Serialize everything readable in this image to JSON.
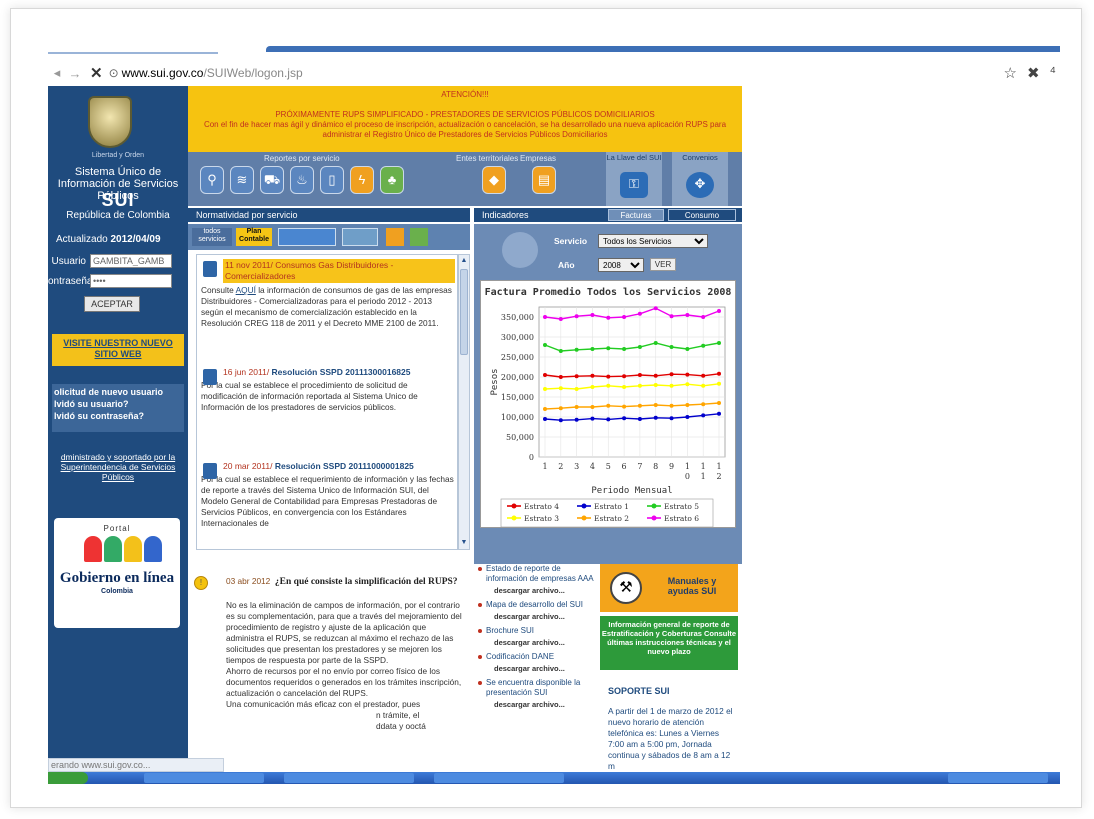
{
  "browser": {
    "url_domain": "www.sui.gov.co",
    "url_path": "/SUIWeb/logon.jsp",
    "status_text": "erando www.sui.gov.co..."
  },
  "left": {
    "motto": "Libertad y Orden",
    "system_name": "Sistema Único de Información de Servicios Públicos",
    "sui": "SUI",
    "republic": "República de Colombia",
    "updated_label": "Actualizado",
    "updated_value": "2012/04/09",
    "user_label": "Usuario",
    "user_value": "GAMBITA_GAMB",
    "password_label": "ontraseña",
    "password_value": "••••",
    "accept": "ACEPTAR",
    "visit": "VISITE NUESTRO NUEVO SITIO WEB",
    "help_1": "olicitud de nuevo usuario",
    "help_2": "lvidó su usuario?",
    "help_3": "lvidó su contraseña?",
    "admin": "dministrado y soportado por la Superintendencia de Servicios Públicos",
    "portal": "Portal",
    "gob": "Gobierno en línea",
    "colombia": "Colombia"
  },
  "notice": {
    "title": "ATENCIÓN!!!",
    "line1": "PRÓXIMAMENTE RUPS SIMPLIFICADO - PRESTADORES DE SERVICIOS PÚBLICOS DOMICILIARIOS",
    "line2": "Con el fin de hacer mas ágil y dinámico el proceso de inscripción, actualización o cancelación, se ha desarrollado una nueva aplicación RUPS para administrar el Registro Único de Prestadores de Servicios Públicos Domiciliarios"
  },
  "iconband": {
    "reportes": "Reportes por servicio",
    "entes": "Entes territoriales",
    "empresas": "Empresas",
    "llave": "La Llave del SUI",
    "convenios": "Convenios"
  },
  "sections": {
    "normatividad": "Normatividad por servicio",
    "indicadores": "Indicadores",
    "facturas": "Facturas",
    "consumo": "Consumo",
    "todos": "todos servicios",
    "plan": "Plan Contable"
  },
  "news": [
    {
      "date": "11 nov 2011",
      "title": "Consumos Gas Distribuidores - Comercializadores",
      "body_a": "Consulte ",
      "link": "AQUÍ",
      "body_b": " la información de consumos de gas de las empresas Distribuidores - Comercializadoras para el periodo 2012 - 2013 según el mecanismo de comercialización establecido en la Resolución CREG 118 de 2011 y el Decreto MME 2100 de 2011."
    },
    {
      "date": "16 jun 2011",
      "title": "Resolución SSPD 20111300016825",
      "body": "Por la cual se establece el procedimiento de solicitud de modificación de información reportada al Sistema Unico de Información de los prestadores de servicios públicos."
    },
    {
      "date": "20 mar 2011",
      "title": "Resolución SSPD 20111000001825",
      "body": "Por la cual se establece el requerimiento de información y las fechas de reporte a través del Sistema Unico de Información SUI, del Modelo General de Contabilidad para Empresas Prestadoras de Servicios Públicos, en convergencia con los Estándares Internacionales de"
    }
  ],
  "indicators": {
    "servicio_label": "Servicio",
    "servicio_value": "Todos los Servicios",
    "anio_label": "Año",
    "anio_value": "2008",
    "ver": "VER"
  },
  "chart_data": {
    "type": "line",
    "title": "Factura Promedio Todos los Servicios 2008",
    "xlabel": "Periodo Mensual",
    "ylabel": "Pesos",
    "ylim": [
      0,
      375000
    ],
    "yticks": [
      "0",
      "50,000",
      "100,000",
      "150,000",
      "200,000",
      "250,000",
      "300,000",
      "350,000"
    ],
    "categories": [
      "1",
      "2",
      "3",
      "4",
      "5",
      "6",
      "7",
      "8",
      "9",
      "10",
      "11",
      "12"
    ],
    "grid": true,
    "legend_position": "bottom",
    "series": [
      {
        "name": "Estrato 4",
        "color": "#e00000",
        "values": [
          205000,
          200000,
          202000,
          203000,
          201000,
          202000,
          205000,
          203000,
          207000,
          206000,
          203000,
          208000
        ]
      },
      {
        "name": "Estrato 1",
        "color": "#0000cc",
        "values": [
          95000,
          92000,
          93000,
          96000,
          94000,
          97000,
          95000,
          98000,
          97000,
          100000,
          104000,
          108000
        ]
      },
      {
        "name": "Estrato 5",
        "color": "#22cc22",
        "values": [
          280000,
          265000,
          268000,
          270000,
          272000,
          270000,
          275000,
          285000,
          275000,
          270000,
          278000,
          285000
        ]
      },
      {
        "name": "Estrato 3",
        "color": "#ffff00",
        "values": [
          170000,
          172000,
          170000,
          175000,
          178000,
          175000,
          178000,
          180000,
          178000,
          182000,
          178000,
          183000
        ]
      },
      {
        "name": "Estrato 2",
        "color": "#ffa500",
        "values": [
          120000,
          122000,
          125000,
          125000,
          128000,
          126000,
          128000,
          130000,
          128000,
          130000,
          132000,
          135000
        ]
      },
      {
        "name": "Estrato 6",
        "color": "#ee00ee",
        "values": [
          350000,
          345000,
          352000,
          355000,
          348000,
          350000,
          358000,
          372000,
          352000,
          355000,
          350000,
          365000
        ]
      }
    ]
  },
  "faq": {
    "date": "03 abr 2012",
    "question": "¿En qué consiste la simplificación del RUPS?",
    "body": "No es la eliminación de campos de información, por el contrario es su complementación, para que a través del mejoramiento del procedimiento de registro y ajuste de la aplicación que administra el RUPS, se reduzcan al máximo el rechazo de las solicitudes que presentan los prestadores y se mejoren los tiempos de respuesta por parte de la SSPD.",
    "body2": "Ahorro de recursos por el no envío por correo físico de los documentos requeridos o generados en los trámites inscripción, actualización o cancelación del RUPS.",
    "body3": "Una comunicación más eficaz con el prestador, pues",
    "body4": "n trámite, el",
    "body5": "ddata y ooctá"
  },
  "links": [
    {
      "label": "Estado de reporte de información de empresas AAA"
    },
    {
      "label": "Mapa de desarrollo del SUI"
    },
    {
      "label": "Brochure SUI"
    },
    {
      "label": "Codificación DANE"
    },
    {
      "label": "Se encuentra disponible la presentación SUI"
    }
  ],
  "download": "descargar archivo...",
  "manual": "Manuales y ayudas SUI",
  "green": "Información general de reporte de Estratificación y Coberturas Consulte últimas instrucciones técnicas y el nuevo plazo",
  "soporte": {
    "title": "SOPORTE SUI",
    "body": "A partir del 1 de marzo de 2012 el nuevo horario de atención telefónica es: Lunes a Viernes 7:00 am a 5:00 pm, Jornada continua y sábados de 8 am a 12 m"
  }
}
